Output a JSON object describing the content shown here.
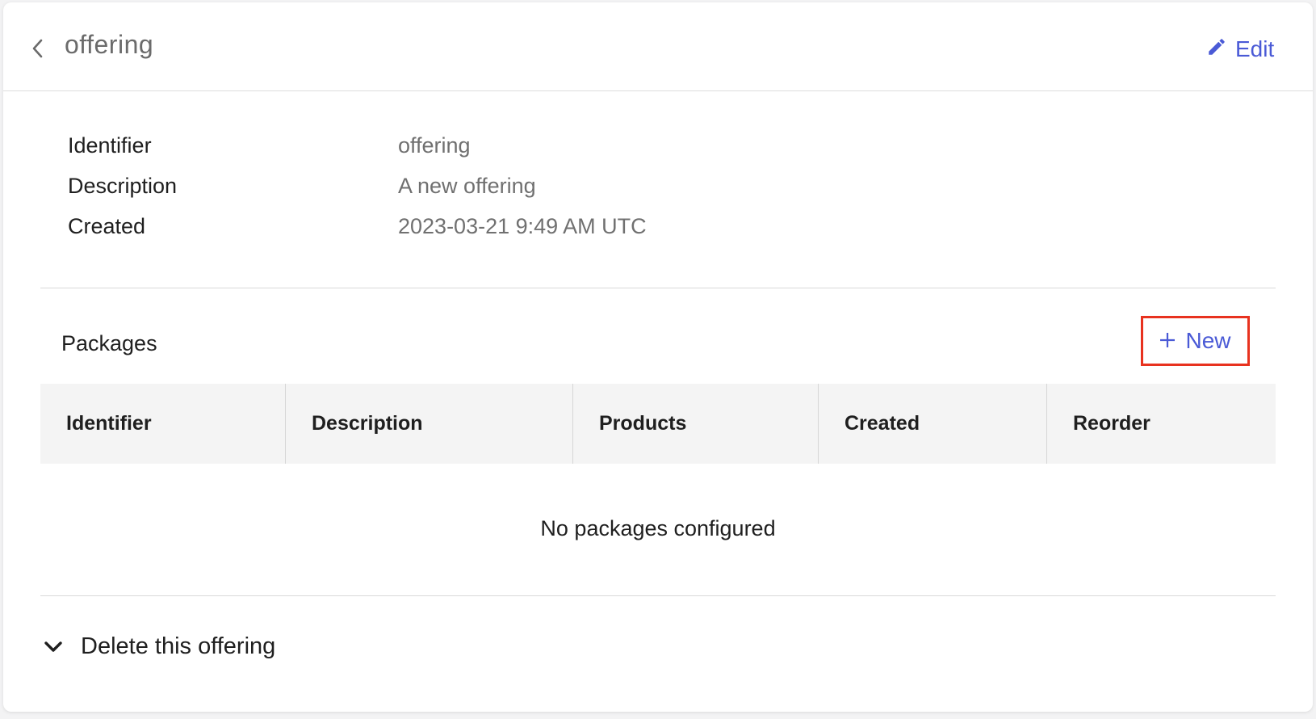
{
  "header": {
    "title": "offering",
    "edit_label": "Edit",
    "accent_color": "#4a5ad6"
  },
  "details": [
    {
      "label": "Identifier",
      "value": "offering"
    },
    {
      "label": "Description",
      "value": "A new offering"
    },
    {
      "label": "Created",
      "value": "2023-03-21 9:49 AM UTC"
    }
  ],
  "packages": {
    "title": "Packages",
    "new_label": "New",
    "highlight_color": "#e8321f",
    "columns": [
      "Identifier",
      "Description",
      "Products",
      "Created",
      "Reorder"
    ],
    "empty_message": "No packages configured"
  },
  "danger": {
    "toggle_label": "Delete this offering"
  },
  "icons": {
    "back": "chevron-left-icon",
    "edit": "pencil-icon",
    "new": "plus-icon",
    "toggle": "chevron-down-icon"
  }
}
